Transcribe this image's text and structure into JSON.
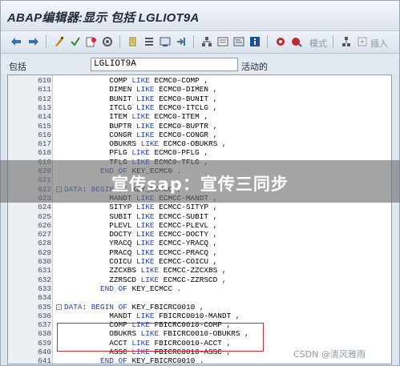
{
  "window": {
    "title": "ABAP编辑器:显示 包括 LGLIOT9A"
  },
  "toolbar": {
    "mode_label": "模式",
    "insert_label": "插入"
  },
  "fields": {
    "include_label": "包括",
    "include_value": "LGLIOT9A",
    "status": "活动的"
  },
  "banner": {
    "text": "宣传sap：宣传三同步"
  },
  "watermark": {
    "text": "CSDN @清风雅雨"
  },
  "lines": [
    {
      "num": "610",
      "fold": "",
      "code": "          COMP LIKE ECMC0-COMP ,"
    },
    {
      "num": "611",
      "fold": "",
      "code": "          DIMEN LIKE ECMC0-DIMEN ,"
    },
    {
      "num": "612",
      "fold": "",
      "code": "          BUNIT LIKE ECMC0-BUNIT ,"
    },
    {
      "num": "613",
      "fold": "",
      "code": "          ITCLG LIKE ECMC0-ITCLG ,"
    },
    {
      "num": "614",
      "fold": "",
      "code": "          ITEM LIKE ECMC0-ITEM ,"
    },
    {
      "num": "615",
      "fold": "",
      "code": "          BUPTR LIKE ECMC0-BUPTR ,"
    },
    {
      "num": "616",
      "fold": "",
      "code": "          CONGR LIKE ECMC0-CONGR ,"
    },
    {
      "num": "617",
      "fold": "",
      "code": "          OBUKRS LIKE ECMC0-OBUKRS ,"
    },
    {
      "num": "618",
      "fold": "",
      "code": "          PFLG LIKE ECMC0-PFLG ,"
    },
    {
      "num": "619",
      "fold": "",
      "code": "          TFLG LIKE ECMC0-TFLG ,"
    },
    {
      "num": "620",
      "fold": "",
      "code": "        END OF KEY_ECMC0 ."
    },
    {
      "num": "621",
      "fold": "",
      "code": ""
    },
    {
      "num": "622",
      "fold": "-",
      "code": "DATA: BEGIN OF KEY_ECMCC ,"
    },
    {
      "num": "623",
      "fold": "",
      "code": "          MANDT LIKE ECMCC-MANDT ,"
    },
    {
      "num": "624",
      "fold": "",
      "code": "          SITYP LIKE ECMCC-SITYP ,"
    },
    {
      "num": "625",
      "fold": "",
      "code": "          SUBIT LIKE ECMCC-SUBIT ,"
    },
    {
      "num": "626",
      "fold": "",
      "code": "          PLEVL LIKE ECMCC-PLEVL ,"
    },
    {
      "num": "627",
      "fold": "",
      "code": "          DOCTY LIKE ECMCC-DOCTY ,"
    },
    {
      "num": "628",
      "fold": "",
      "code": "          YRACQ LIKE ECMCC-YRACQ ,"
    },
    {
      "num": "629",
      "fold": "",
      "code": "          PRACQ LIKE ECMCC-PRACQ ,"
    },
    {
      "num": "630",
      "fold": "",
      "code": "          COICU LIKE ECMCC-COICU ,"
    },
    {
      "num": "631",
      "fold": "",
      "code": "          ZZCXBS LIKE ECMCC-ZZCXBS ,"
    },
    {
      "num": "632",
      "fold": "",
      "code": "          ZZRSCD LIKE ECMCC-ZZRSCD ,"
    },
    {
      "num": "633",
      "fold": "",
      "code": "        END OF KEY_ECMCC ."
    },
    {
      "num": "634",
      "fold": "",
      "code": ""
    },
    {
      "num": "635",
      "fold": "-",
      "code": "DATA: BEGIN OF KEY_FBICRC0010 ,"
    },
    {
      "num": "636",
      "fold": "",
      "code": "          MANDT LIKE FBICRC0010-MANDT ,"
    },
    {
      "num": "637",
      "fold": "",
      "code": "          COMP LIKE FBICRC0010-COMP ,"
    },
    {
      "num": "638",
      "fold": "",
      "code": "          OBUKRS LIKE FBICRC0010-OBUKRS ,"
    },
    {
      "num": "639",
      "fold": "",
      "code": "          ACCT LIKE FBICRC0010-ACCT ,"
    },
    {
      "num": "640",
      "fold": "",
      "code": "          ASSC LIKE FBICRC0010-ASSC ,"
    },
    {
      "num": "641",
      "fold": "",
      "code": "        END OF KEY_FBICRC0010 ."
    }
  ]
}
